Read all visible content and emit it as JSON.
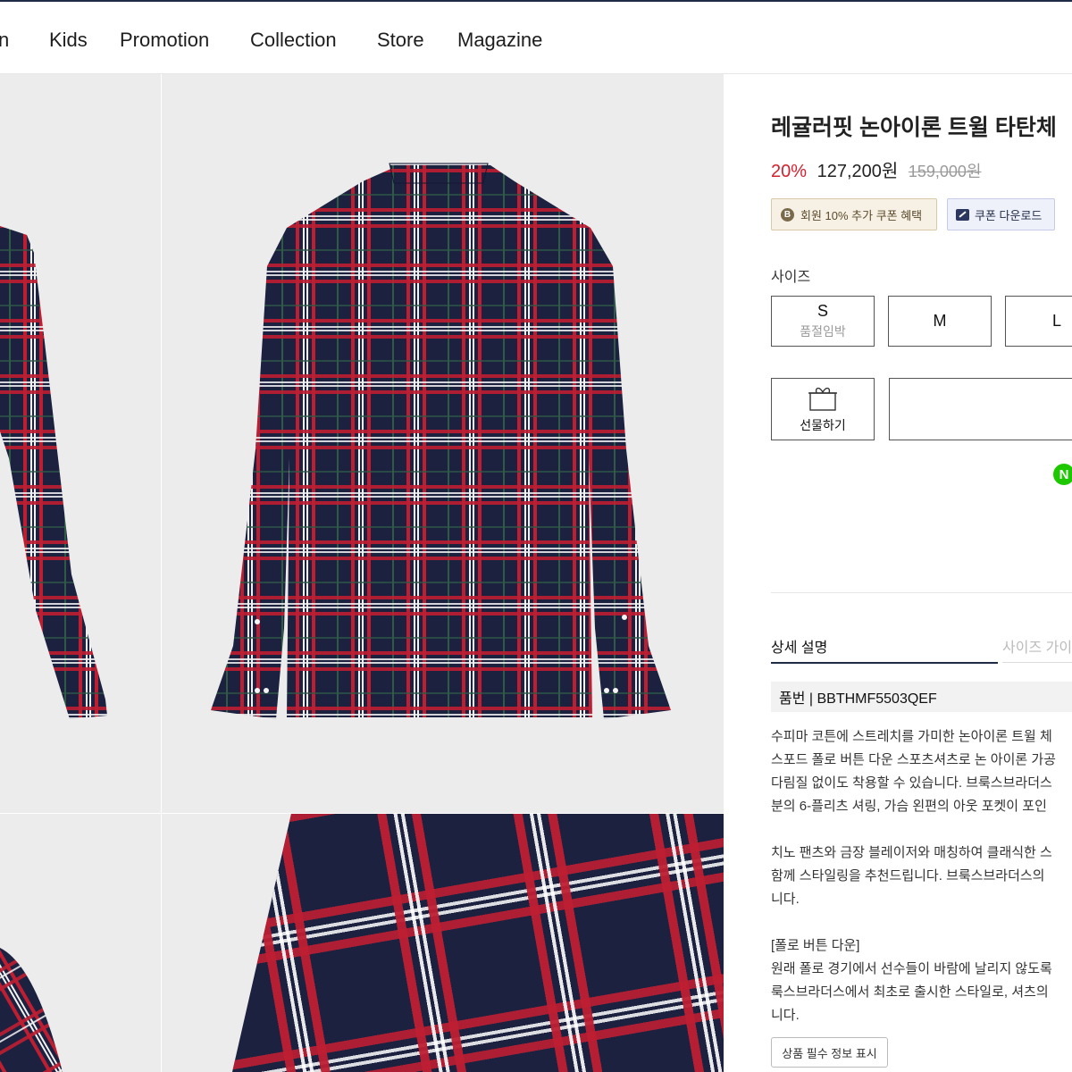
{
  "nav": {
    "items": [
      {
        "label": "n"
      },
      {
        "label": "Kids"
      },
      {
        "label": "Promotion"
      },
      {
        "label": "Collection"
      },
      {
        "label": "Store"
      },
      {
        "label": "Magazine"
      }
    ]
  },
  "product": {
    "title": "레귤러핏 논아이론 트윌 타탄체",
    "discount": "20%",
    "price": "127,200원",
    "original_price": "159,000원",
    "coupon_member": "회원 10% 추가 쿠폰 혜택",
    "coupon_member_icon": "B",
    "coupon_download": "쿠폰 다운로드",
    "size_label": "사이즈",
    "sizes": [
      {
        "name": "S",
        "status": "품절임박"
      },
      {
        "name": "M",
        "status": ""
      },
      {
        "name": "L",
        "status": ""
      }
    ],
    "gift_label": "선물하기",
    "npay_icon": "N",
    "tabs": {
      "detail": "상세 설명",
      "size_guide": "사이즈 가이"
    },
    "sku": "품번 | BBTHMF5503QEF",
    "description": [
      "수피마 코튼에 스트레치를 가미한 논아이론 트윌 체",
      "스포드 폴로 버튼 다운 스포츠셔츠로 논 아이론 가공",
      "다림질 없이도 착용할 수 있습니다. 브룩스브라더스",
      "분의 6-플리츠 셔링, 가슴 왼편의 아웃 포켓이 포인",
      "",
      "치노 팬츠와 금장 블레이저와 매칭하여 클래식한 스",
      "함께 스타일링을 추천드립니다. 브룩스브라더스의",
      "니다.",
      "",
      "[폴로 버튼 다운]",
      "원래 폴로 경기에서 선수들이 바람에 날리지 않도록",
      "룩스브라더스에서 최초로 출시한 스타일로, 셔츠의",
      "니다."
    ],
    "notice_button": "상품 필수 정보 표시"
  },
  "colors": {
    "navy": "#1f2a44",
    "discount_red": "#d2202f",
    "npay_green": "#1ec800"
  }
}
